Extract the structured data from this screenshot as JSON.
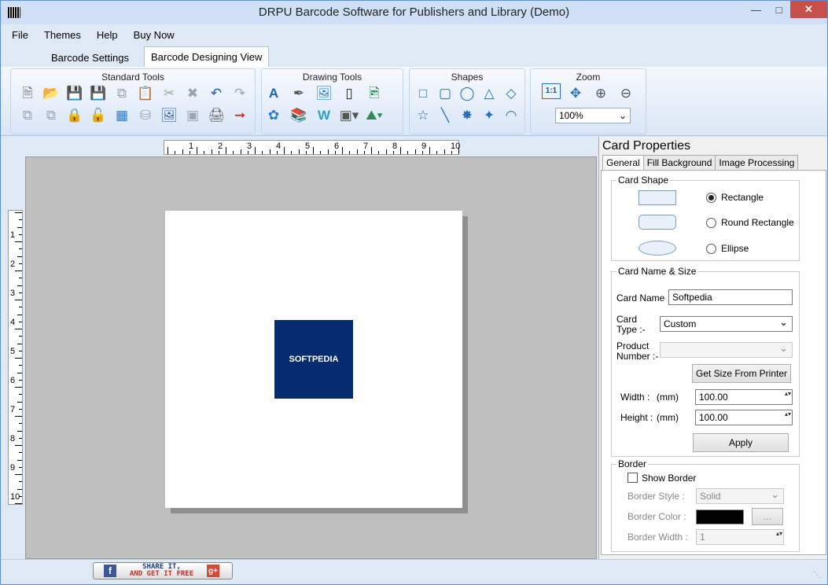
{
  "window": {
    "title": "DRPU Barcode Software for Publishers and Library (Demo)"
  },
  "menu": [
    "File",
    "Themes",
    "Help",
    "Buy Now"
  ],
  "tabs": [
    "Barcode Settings",
    "Barcode Designing View"
  ],
  "ribbon": {
    "groups": [
      "Standard Tools",
      "Drawing Tools",
      "Shapes",
      "Zoom"
    ],
    "zoom_value": "100%",
    "zoom_one": "1:1"
  },
  "ruler": {
    "h": [
      "1",
      "2",
      "3",
      "4",
      "5",
      "6",
      "7",
      "8",
      "9",
      "10"
    ],
    "v": [
      "1",
      "2",
      "3",
      "4",
      "5",
      "6",
      "7",
      "8",
      "9",
      "10"
    ]
  },
  "canvas": {
    "logo_text": "SOFTPEDIA"
  },
  "properties": {
    "title": "Card Properties",
    "tabs": [
      "General",
      "Fill Background",
      "Image Processing"
    ],
    "card_shape": {
      "legend": "Card Shape",
      "options": [
        "Rectangle",
        "Round Rectangle",
        "Ellipse"
      ]
    },
    "name_size": {
      "legend": "Card  Name & Size",
      "card_name_label": "Card Name :",
      "card_name_value": "Softpedia",
      "card_type_label1": "Card",
      "card_type_label2": "Type :-",
      "card_type_value": "Custom",
      "product_label1": "Product",
      "product_label2": "Number :-",
      "get_size_button": "Get Size From Printer",
      "width_label": "Width :",
      "height_label": "Height :",
      "unit": "(mm)",
      "width_value": "100.00",
      "height_value": "100.00",
      "apply_button": "Apply"
    },
    "border": {
      "legend": "Border",
      "show_border": "Show Border",
      "style_label": "Border Style :",
      "style_value": "Solid",
      "color_label": "Border Color :",
      "color_value": "#000000",
      "color_button": "...",
      "width_label": "Border Width :",
      "width_value": "1"
    }
  },
  "status": {
    "share_line1": "SHARE IT,",
    "share_line2": "AND GET IT FREE"
  }
}
